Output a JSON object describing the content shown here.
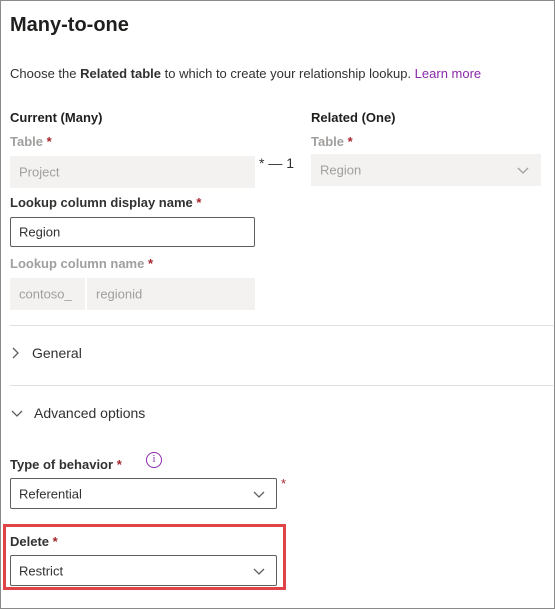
{
  "title": "Many-to-one",
  "description": {
    "prefix": "Choose the ",
    "bold": "Related table",
    "suffix": " to which to create your relationship lookup. ",
    "link": "Learn more"
  },
  "current": {
    "heading": "Current (Many)",
    "table_label": "Table",
    "table_value": "Project"
  },
  "related": {
    "heading": "Related (One)",
    "table_label": "Table",
    "table_value": "Region"
  },
  "cardinality": {
    "many": "*",
    "dash": "—",
    "one": "1"
  },
  "required_marker": "*",
  "lookup_display": {
    "label": "Lookup column display name",
    "value": "Region"
  },
  "lookup_name": {
    "label": "Lookup column name",
    "prefix": "contoso_",
    "value": "regionid"
  },
  "sections": {
    "general": "General",
    "advanced": "Advanced options"
  },
  "behavior": {
    "label": "Type of behavior",
    "value": "Referential",
    "info_icon": "i"
  },
  "delete": {
    "label": "Delete",
    "value": "Restrict"
  },
  "colors": {
    "link": "#8b2aa8",
    "required": "#a4262c",
    "highlight": "#e04348"
  }
}
